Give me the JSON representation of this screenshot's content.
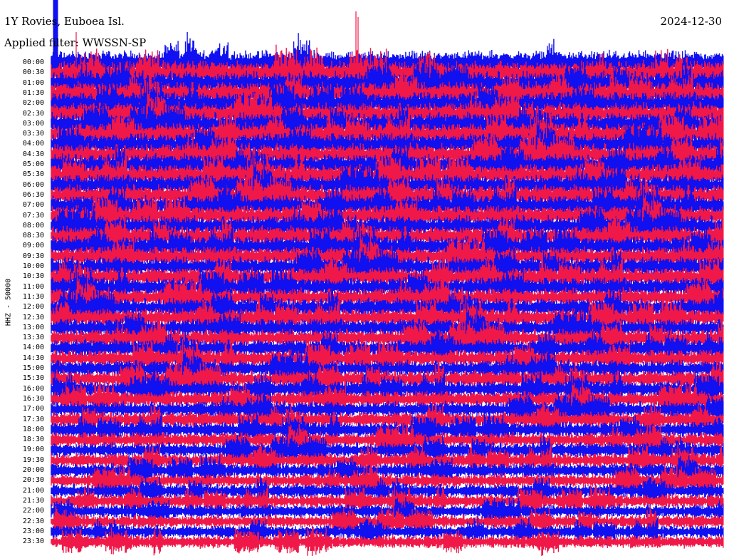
{
  "header": {
    "station": "1Y Rovies, Euboea Isl.",
    "filter": "Applied filter: WWSSN-SP",
    "date": "2024-12-30"
  },
  "axis": {
    "channel_label": "HHZ - 50000"
  },
  "colors": {
    "trace_a": "#1010f0",
    "trace_b": "#f01848",
    "background": "#ffffff",
    "text": "#000000"
  },
  "chart_data": {
    "type": "helicorder",
    "title": "1Y Rovies, Euboea Isl.",
    "subtitle": "Applied filter: WWSSN-SP",
    "ylabel": "HHZ - 50000",
    "date": "2024-12-30",
    "row_interval_minutes": 30,
    "row_colors_cycle": [
      "trace_a",
      "trace_b"
    ],
    "rows": [
      "00:00",
      "00:30",
      "01:00",
      "01:30",
      "02:00",
      "02:30",
      "03:00",
      "03:30",
      "04:00",
      "04:30",
      "05:00",
      "05:30",
      "06:00",
      "06:30",
      "07:00",
      "07:30",
      "08:00",
      "08:30",
      "09:00",
      "09:30",
      "10:00",
      "10:30",
      "11:00",
      "11:30",
      "12:00",
      "12:30",
      "13:00",
      "13:30",
      "14:00",
      "14:30",
      "15:00",
      "15:30",
      "16:00",
      "16:30",
      "17:00",
      "17:30",
      "18:00",
      "18:30",
      "19:00",
      "19:30",
      "20:00",
      "20:30",
      "21:00",
      "21:30",
      "22:00",
      "22:30",
      "23:00",
      "23:30"
    ]
  }
}
